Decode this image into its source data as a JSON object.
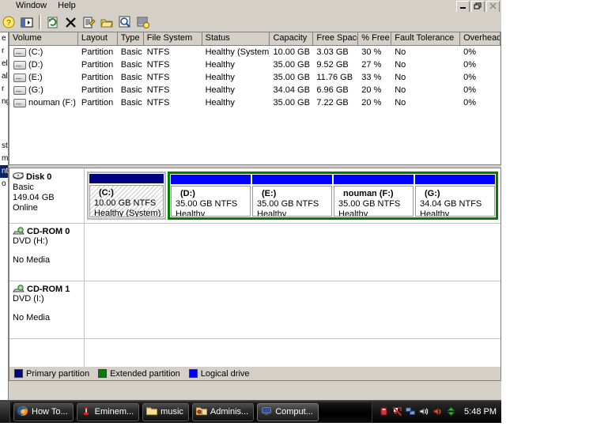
{
  "window": {
    "menu": [
      "",
      "Window",
      "Help"
    ],
    "buttons": {
      "minimize": "_",
      "restore": "❐",
      "close": "✕"
    },
    "toolbar_icons": [
      "help-icon",
      "show-hide-console-tree-icon",
      "refresh-icon",
      "delete-icon",
      "properties-icon",
      "open-icon",
      "find-icon",
      "rescan-disks-icon"
    ]
  },
  "tree_strip": [
    "e",
    "r",
    "el",
    "al",
    "r",
    "ng",
    "st",
    "m",
    "nt",
    "o"
  ],
  "volume_list": {
    "columns": [
      "Volume",
      "Layout",
      "Type",
      "File System",
      "Status",
      "Capacity",
      "Free Space",
      "% Free",
      "Fault Tolerance",
      "Overhead"
    ],
    "rows": [
      {
        "volume": "(C:)",
        "layout": "Partition",
        "type": "Basic",
        "fs": "NTFS",
        "status": "Healthy (System)",
        "capacity": "10.00 GB",
        "free": "3.03 GB",
        "pctfree": "30 %",
        "fault": "No",
        "overhead": "0%"
      },
      {
        "volume": "(D:)",
        "layout": "Partition",
        "type": "Basic",
        "fs": "NTFS",
        "status": "Healthy",
        "capacity": "35.00 GB",
        "free": "9.52 GB",
        "pctfree": "27 %",
        "fault": "No",
        "overhead": "0%"
      },
      {
        "volume": "(E:)",
        "layout": "Partition",
        "type": "Basic",
        "fs": "NTFS",
        "status": "Healthy",
        "capacity": "35.00 GB",
        "free": "11.76 GB",
        "pctfree": "33 %",
        "fault": "No",
        "overhead": "0%"
      },
      {
        "volume": "(G:)",
        "layout": "Partition",
        "type": "Basic",
        "fs": "NTFS",
        "status": "Healthy",
        "capacity": "34.04 GB",
        "free": "6.96 GB",
        "pctfree": "20 %",
        "fault": "No",
        "overhead": "0%"
      },
      {
        "volume": "nouman (F:)",
        "layout": "Partition",
        "type": "Basic",
        "fs": "NTFS",
        "status": "Healthy",
        "capacity": "35.00 GB",
        "free": "7.22 GB",
        "pctfree": "20 %",
        "fault": "No",
        "overhead": "0%"
      }
    ]
  },
  "disk_graph": {
    "disk0": {
      "name": "Disk 0",
      "type": "Basic",
      "size": "149.04 GB",
      "state": "Online",
      "primary": {
        "label": "(C:)",
        "size": "10.00 GB NTFS",
        "status": "Healthy (System)"
      },
      "logical": [
        {
          "label": "(D:)",
          "size": "35.00 GB NTFS",
          "status": "Healthy"
        },
        {
          "label": "(E:)",
          "size": "35.00 GB NTFS",
          "status": "Healthy"
        },
        {
          "label": "nouman  (F:)",
          "size": "35.00 GB NTFS",
          "status": "Healthy"
        },
        {
          "label": "(G:)",
          "size": "34.04 GB NTFS",
          "status": "Healthy"
        }
      ]
    },
    "cdrom0": {
      "name": "CD-ROM 0",
      "drive": "DVD (H:)",
      "media": "No Media"
    },
    "cdrom1": {
      "name": "CD-ROM 1",
      "drive": "DVD (I:)",
      "media": "No Media"
    }
  },
  "legend": [
    {
      "label": "Primary partition",
      "color": "#000080"
    },
    {
      "label": "Extended partition",
      "color": "#008000"
    },
    {
      "label": "Logical drive",
      "color": "#0000ff"
    }
  ],
  "taskbar": {
    "buttons": [
      {
        "label": "How To...",
        "icon": "firefox-icon"
      },
      {
        "label": "Eminem...",
        "icon": "media-player-icon"
      },
      {
        "label": "music",
        "icon": "folder-icon"
      },
      {
        "label": "Adminis...",
        "icon": "admin-tools-folder-icon"
      },
      {
        "label": "Comput...",
        "icon": "computer-management-icon"
      }
    ],
    "tray_icons": [
      "usb-device-icon",
      "antivirus-icon",
      "network-icon",
      "volume-icon",
      "sound-icon",
      "updown-arrows-icon"
    ],
    "clock": "5:48 PM"
  }
}
